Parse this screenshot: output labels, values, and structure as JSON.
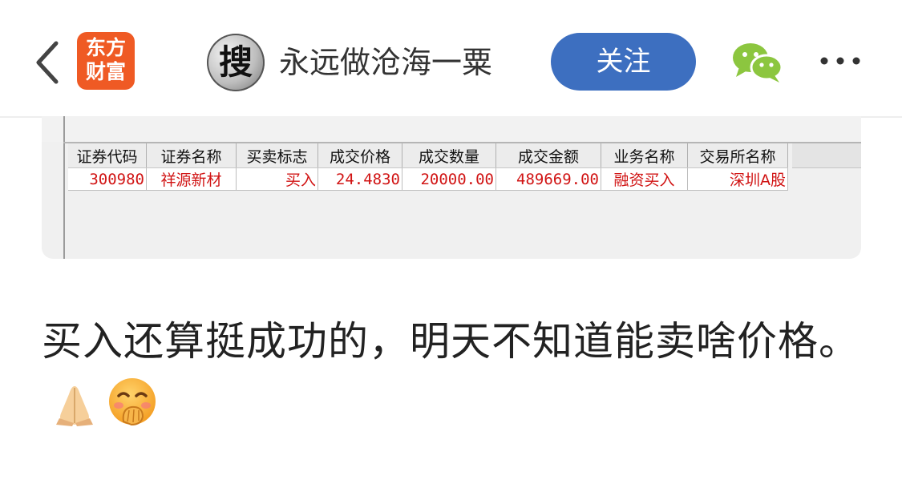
{
  "header": {
    "logo_line1": "东方",
    "logo_line2": "财富",
    "avatar_glyph": "搜",
    "username": "永远做沧海一粟",
    "follow_label": "关注",
    "icons": [
      "back-icon",
      "wechat-icon",
      "more-icon"
    ],
    "accent_color": "#3d6fc0",
    "logo_color": "#ef5a24"
  },
  "trade_table": {
    "columns": [
      "证券代码",
      "证券名称",
      "买卖标志",
      "成交价格",
      "成交数量",
      "成交金额",
      "业务名称",
      "交易所名称"
    ],
    "rows": [
      [
        "300980",
        "祥源新材",
        "买入",
        "24.4830",
        "20000.00",
        "489669.00",
        "融资买入",
        "深圳A股"
      ]
    ],
    "value_color": "#d11414"
  },
  "post": {
    "text": "买入还算挺成功的，明天不知道能卖啥价格。",
    "emojis": [
      "folded-hands-icon",
      "hand-over-mouth-smile-icon"
    ]
  }
}
